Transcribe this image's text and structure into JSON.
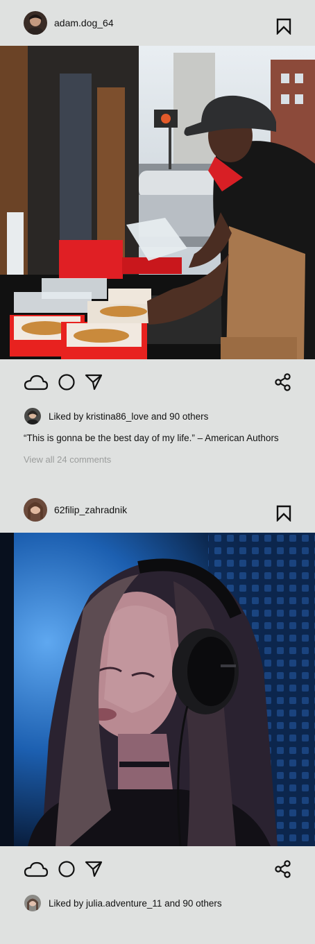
{
  "posts": [
    {
      "username": "adam.dog_64",
      "photo": "street-food-vendor-photo",
      "liked_by": "Liked by kristina86_love and 90 others",
      "caption": "“This is gonna be the best day of my life.” – American Authors",
      "comments_link": "View all 24 comments"
    },
    {
      "username": "62filip_zahradnik",
      "photo": "woman-with-headphones-photo",
      "liked_by": "Liked by julia.adventure_11 and 90 others"
    }
  ],
  "icons": {
    "like": "cloud-icon",
    "comment": "circle-icon",
    "send": "send-icon",
    "share": "share-icon",
    "save": "bookmark-icon"
  },
  "colors": {
    "background": "#dfe1e0",
    "text": "#111111",
    "muted": "#9b9d9c"
  }
}
